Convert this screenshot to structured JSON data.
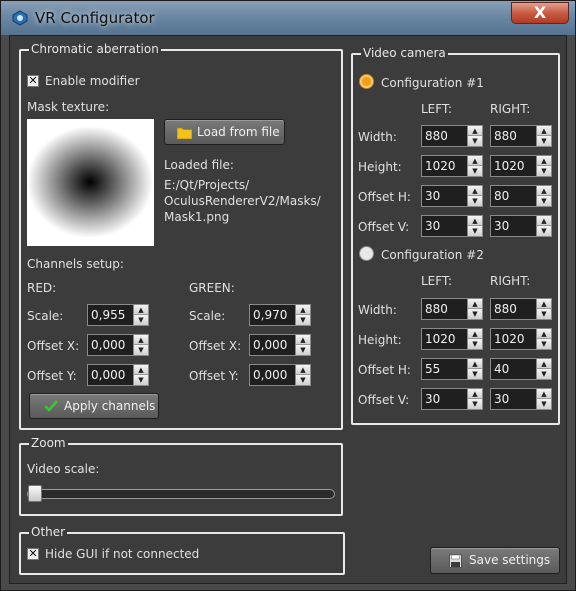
{
  "window": {
    "title": "VR Configurator",
    "close_label": "X"
  },
  "chromatic": {
    "title": "Chromatic aberration",
    "enable_label": "Enable modifier",
    "enable_checked": true,
    "mask_label": "Mask texture:",
    "load_button": "Load from file",
    "loaded_file_label": "Loaded file:",
    "loaded_file_lines": [
      "E:/Qt/Projects/",
      "OculusRendererV2/Masks/",
      "Mask1.png"
    ],
    "channels_label": "Channels setup:",
    "red": {
      "title": "RED:",
      "scale_label": "Scale:",
      "scale": "0,955",
      "offx_label": "Offset X:",
      "offx": "0,000",
      "offy_label": "Offset Y:",
      "offy": "0,000"
    },
    "green": {
      "title": "GREEN:",
      "scale_label": "Scale:",
      "scale": "0,970",
      "offx_label": "Offset X:",
      "offx": "0,000",
      "offy_label": "Offset Y:",
      "offy": "0,000"
    },
    "apply_button": "Apply channels"
  },
  "zoom": {
    "title": "Zoom",
    "label": "Video scale:",
    "value_fraction": 0.0
  },
  "other": {
    "title": "Other",
    "hide_label": "Hide GUI if not connected",
    "hide_checked": true
  },
  "camera": {
    "title": "Video camera",
    "left_label": "LEFT:",
    "right_label": "RIGHT:",
    "row_labels": {
      "width": "Width:",
      "height": "Height:",
      "offh": "Offset H:",
      "offv": "Offset V:"
    },
    "configs": [
      {
        "label": "Configuration #1",
        "selected": true,
        "width": [
          "880",
          "880"
        ],
        "height": [
          "1020",
          "1020"
        ],
        "offh": [
          "30",
          "80"
        ],
        "offv": [
          "30",
          "30"
        ]
      },
      {
        "label": "Configuration #2",
        "selected": false,
        "width": [
          "880",
          "880"
        ],
        "height": [
          "1020",
          "1020"
        ],
        "offh": [
          "55",
          "40"
        ],
        "offv": [
          "30",
          "30"
        ]
      }
    ]
  },
  "save_button": "Save settings",
  "colors": {
    "accent_radio": "#f59d14",
    "check_green": "#35c92f",
    "folder_yellow": "#f2c21b"
  }
}
